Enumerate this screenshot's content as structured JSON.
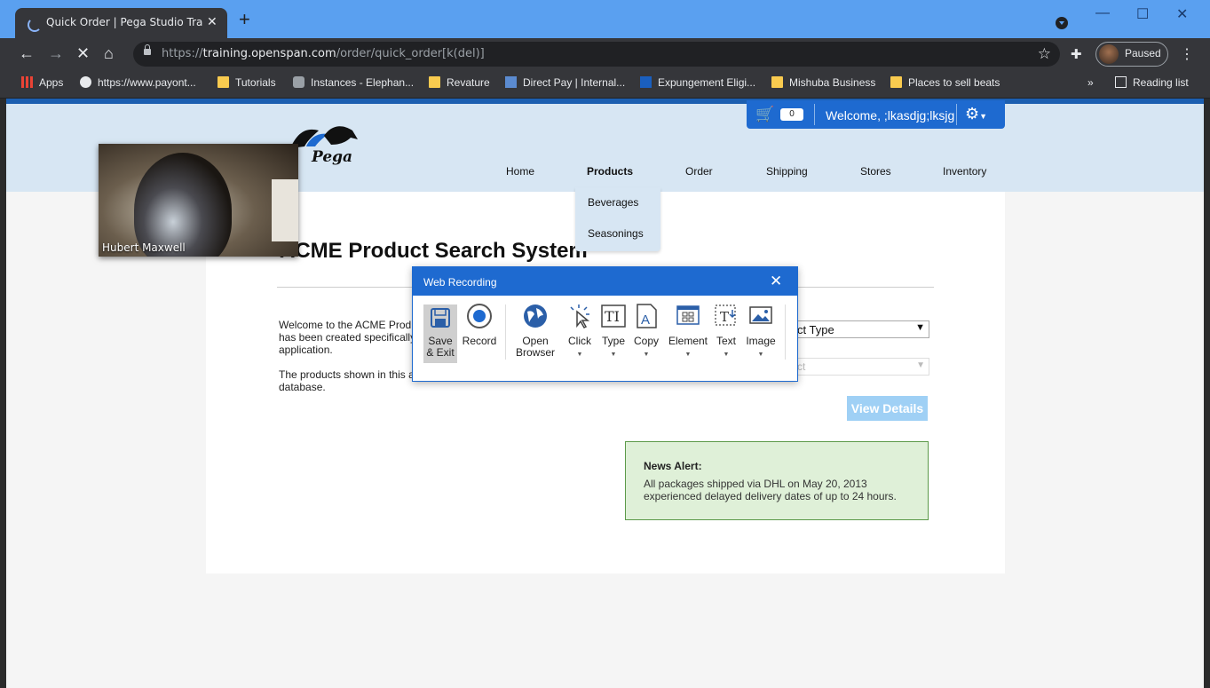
{
  "browser": {
    "tab_title": "Quick Order | Pega Studio Trainin",
    "url_prefix": "https://",
    "url_host": "training.openspan.com",
    "url_path": "/order/quick_order[k(del)]",
    "profile_label": "Paused",
    "bookmarks": [
      {
        "label": "Apps"
      },
      {
        "label": "https://www.payont..."
      },
      {
        "label": "Tutorials"
      },
      {
        "label": "Instances - Elephan..."
      },
      {
        "label": "Revature"
      },
      {
        "label": "Direct Pay | Internal..."
      },
      {
        "label": "Expungement Eligi..."
      },
      {
        "label": "Mishuba Business"
      },
      {
        "label": "Places to sell beats"
      },
      {
        "label": "»"
      },
      {
        "label": "Reading list"
      }
    ]
  },
  "site": {
    "cart_count": "0",
    "welcome": "Welcome, ;lkasdjg;lksjg",
    "logo_text": "Pega",
    "nav": [
      "Home",
      "Products",
      "Order",
      "Shipping",
      "Stores",
      "Inventory"
    ],
    "products_menu": [
      "Beverages",
      "Seasonings"
    ],
    "heading": "ACME Product Search System",
    "intro_lines": [
      "Welcome to the ACME Prod",
      "has been created specifically",
      "application."
    ],
    "products_lines": [
      "The products shown in this a",
      "database."
    ],
    "select_type": "ct Type",
    "select_product": "ct",
    "view_details": "View Details",
    "news_title": "News Alert:",
    "news_body": "All packages shipped via DHL on May 20, 2013 experienced delayed delivery dates of up to 24 hours."
  },
  "webcam": {
    "name": "Hubert Maxwell"
  },
  "recorder": {
    "title": "Web Recording",
    "tools": [
      {
        "label": "Save\n& Exit"
      },
      {
        "label": "Record"
      },
      {
        "label": "Open Browser"
      },
      {
        "label": "Click"
      },
      {
        "label": "Type"
      },
      {
        "label": "Copy"
      },
      {
        "label": "Element"
      },
      {
        "label": "Text"
      },
      {
        "label": "Image"
      }
    ]
  }
}
